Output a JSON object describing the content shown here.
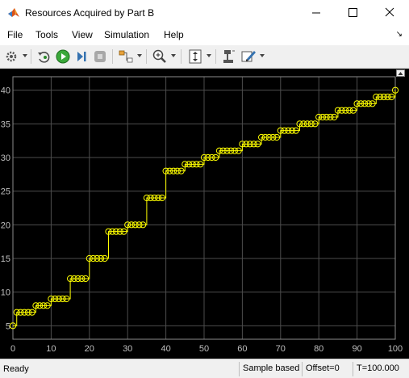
{
  "window": {
    "title": "Resources Acquired by Part B"
  },
  "menu": {
    "items": [
      "File",
      "Tools",
      "View",
      "Simulation",
      "Help"
    ]
  },
  "toolbar": {
    "buttons": [
      "settings-icon",
      "restore-defaults-icon",
      "run-icon",
      "step-forward-icon",
      "stop-icon",
      "highlight-signal-icon",
      "zoom-icon",
      "scale-axes-icon",
      "cursor-measurements-icon",
      "style-icon"
    ]
  },
  "status": {
    "ready": "Ready",
    "sample_mode": "Sample based",
    "offset": "Offset=0",
    "time": "T=100.000"
  },
  "colors": {
    "background": "#000000",
    "grid": "#4d4d4d",
    "trace": "#ffff00",
    "axis_text": "#bfbfbf"
  },
  "chart_data": {
    "type": "line",
    "style": "staircase with circle markers",
    "xlim": [
      0,
      100
    ],
    "ylim": [
      3,
      42
    ],
    "xticks": [
      0,
      10,
      20,
      30,
      40,
      50,
      60,
      70,
      80,
      90,
      100
    ],
    "yticks": [
      5,
      10,
      15,
      20,
      25,
      30,
      35,
      40
    ],
    "grid": true,
    "series": [
      {
        "x": [
          0,
          1,
          2,
          3,
          4,
          5,
          6,
          7,
          8,
          9,
          10,
          11,
          12,
          13,
          14,
          15,
          16,
          17,
          18,
          19,
          20,
          21,
          22,
          23,
          24,
          25,
          26,
          27,
          28,
          29,
          30,
          31,
          32,
          33,
          34,
          35,
          36,
          37,
          38,
          39,
          40,
          41,
          42,
          43,
          44,
          45,
          46,
          47,
          48,
          49,
          50,
          51,
          52,
          53,
          54,
          55,
          56,
          57,
          58,
          59,
          60,
          61,
          62,
          63,
          64,
          65,
          66,
          67,
          68,
          69,
          70,
          71,
          72,
          73,
          74,
          75,
          76,
          77,
          78,
          79,
          80,
          81,
          82,
          83,
          84,
          85,
          86,
          87,
          88,
          89,
          90,
          91,
          92,
          93,
          94,
          95,
          96,
          97,
          98,
          99,
          100
        ],
        "y": [
          5,
          7,
          7,
          7,
          7,
          7,
          8,
          8,
          8,
          8,
          9,
          9,
          9,
          9,
          9,
          12,
          12,
          12,
          12,
          12,
          15,
          15,
          15,
          15,
          15,
          19,
          19,
          19,
          19,
          19,
          20,
          20,
          20,
          20,
          20,
          24,
          24,
          24,
          24,
          24,
          28,
          28,
          28,
          28,
          28,
          29,
          29,
          29,
          29,
          29,
          30,
          30,
          30,
          30,
          31,
          31,
          31,
          31,
          31,
          31,
          32,
          32,
          32,
          32,
          32,
          33,
          33,
          33,
          33,
          33,
          34,
          34,
          34,
          34,
          34,
          35,
          35,
          35,
          35,
          35,
          36,
          36,
          36,
          36,
          36,
          37,
          37,
          37,
          37,
          37,
          38,
          38,
          38,
          38,
          38,
          39,
          39,
          39,
          39,
          39,
          40
        ]
      }
    ]
  }
}
